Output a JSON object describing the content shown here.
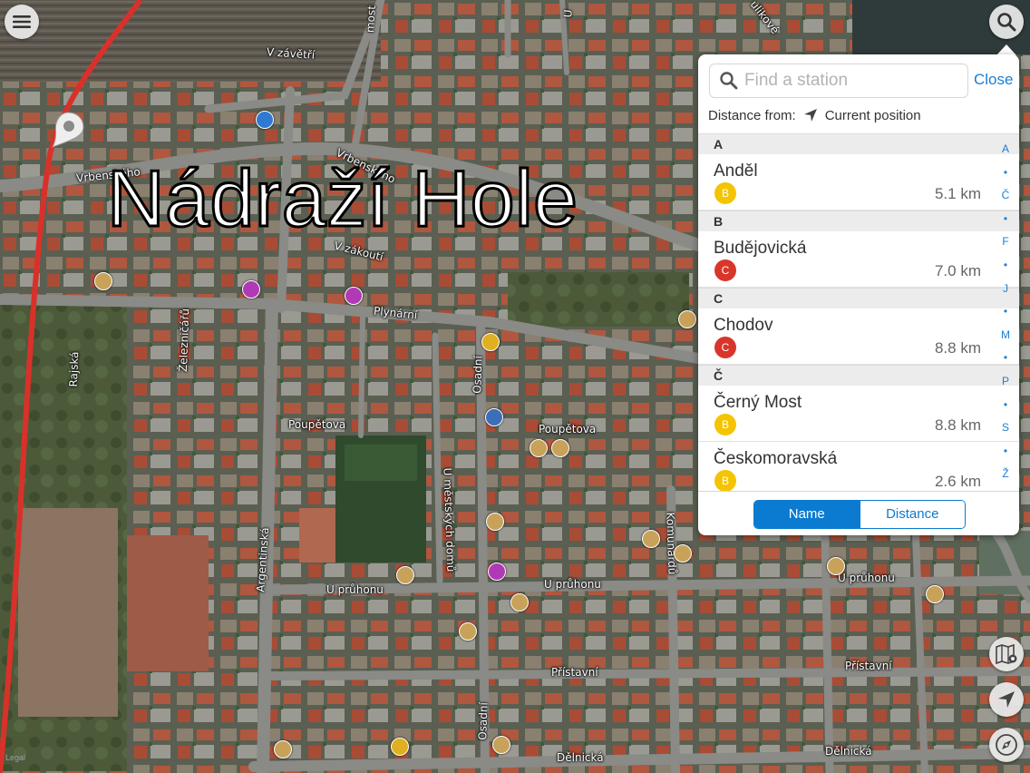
{
  "map": {
    "title": "Nádraží Hole",
    "streets": [
      {
        "id": "v-zavetri",
        "text": "V závětří"
      },
      {
        "id": "vrbenskeho-1",
        "text": "Vrbenského"
      },
      {
        "id": "vrbenskeho-2",
        "text": "Vrbenského"
      },
      {
        "id": "v-zakouti",
        "text": "V zákoutí"
      },
      {
        "id": "plynarni",
        "text": "Plynární"
      },
      {
        "id": "zeleznicaru",
        "text": "Železničářů"
      },
      {
        "id": "rajska",
        "text": "Rajská"
      },
      {
        "id": "osadni-1",
        "text": "Osadní"
      },
      {
        "id": "poupetova-1",
        "text": "Poupětova"
      },
      {
        "id": "poupetova-2",
        "text": "Poupětova"
      },
      {
        "id": "u-mestskych-domu",
        "text": "U městských domů"
      },
      {
        "id": "argentinska",
        "text": "Argentinská"
      },
      {
        "id": "u-pruhonu-1",
        "text": "U průhonu"
      },
      {
        "id": "u-pruhonu-2",
        "text": "U průhonu"
      },
      {
        "id": "u-pruhonu-3",
        "text": "U průhonu"
      },
      {
        "id": "komunardu",
        "text": "Komunardů"
      },
      {
        "id": "pristavni-1",
        "text": "Přístavní"
      },
      {
        "id": "pristavni-2",
        "text": "Přístavní"
      },
      {
        "id": "osadni-2",
        "text": "Osadní"
      },
      {
        "id": "delnicka-1",
        "text": "Dělnická"
      },
      {
        "id": "delnicka-2",
        "text": "Dělnická"
      },
      {
        "id": "most",
        "text": "most"
      },
      {
        "id": "u-top",
        "text": "U"
      },
      {
        "id": "ulikove",
        "text": "ulikové"
      }
    ],
    "watermark": "Legal"
  },
  "colors": {
    "accent": "#0a7bd0",
    "line_b": "#f5c400",
    "line_c": "#d9362b",
    "route": "#d9312a"
  },
  "panel": {
    "search_placeholder": "Find a station",
    "close_label": "Close",
    "distance_from_label": "Distance from:",
    "distance_from_value": "Current position",
    "sections": [
      {
        "letter": "A",
        "items": [
          {
            "name": "Anděl",
            "line": "B",
            "distance": "5.1 km"
          }
        ]
      },
      {
        "letter": "B",
        "items": [
          {
            "name": "Budějovická",
            "line": "C",
            "distance": "7.0 km"
          }
        ]
      },
      {
        "letter": "C",
        "items": [
          {
            "name": "Chodov",
            "line": "C",
            "distance": "8.8 km"
          }
        ]
      },
      {
        "letter": "Č",
        "items": [
          {
            "name": "Černý Most",
            "line": "B",
            "distance": "8.8 km"
          },
          {
            "name": "Českomoravská",
            "line": "B",
            "distance": "2.6 km"
          }
        ]
      }
    ],
    "index": [
      "A",
      "•",
      "Č",
      "•",
      "F",
      "•",
      "J",
      "•",
      "M",
      "•",
      "P",
      "•",
      "S",
      "•",
      "Ž"
    ],
    "sort": {
      "name_label": "Name",
      "distance_label": "Distance",
      "active": "Name"
    }
  },
  "icons": {
    "menu": "menu-icon",
    "search": "search-icon",
    "map_layers": "map-layers-icon",
    "locate": "locate-arrow-icon",
    "compass": "compass-icon",
    "pin": "map-pin-icon"
  }
}
